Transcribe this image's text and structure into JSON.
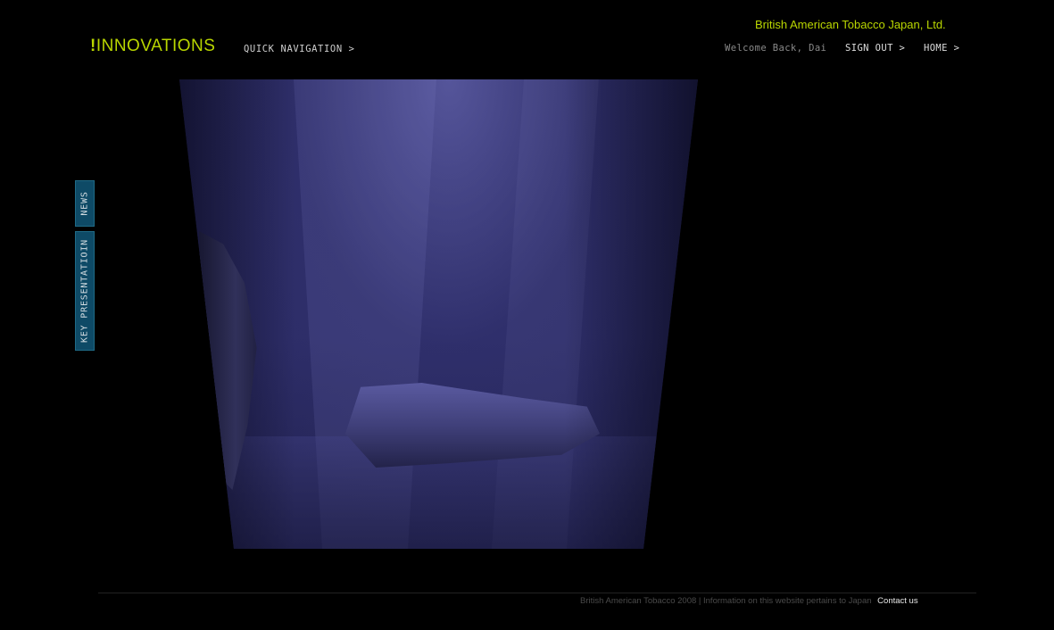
{
  "header": {
    "company": "British American Tobacco Japan, Ltd.",
    "logo_mark": "!",
    "logo_text": "INNOVATIONS",
    "quick_nav": "QUICK NAVIGATION >",
    "welcome": "Welcome Back, Dai",
    "sign_out": "SIGN OUT >",
    "home": "HOME >"
  },
  "side_tabs": {
    "news": "NEWS",
    "key_presentation": "KEY PRESENTATIOIN"
  },
  "footer": {
    "copyright": "British American Tobacco 2008 | Information on this website pertains to Japan",
    "contact": "Contact us"
  },
  "colors": {
    "accent": "#b9d600",
    "tab_bg": "#0e4a66",
    "background": "#000000"
  }
}
